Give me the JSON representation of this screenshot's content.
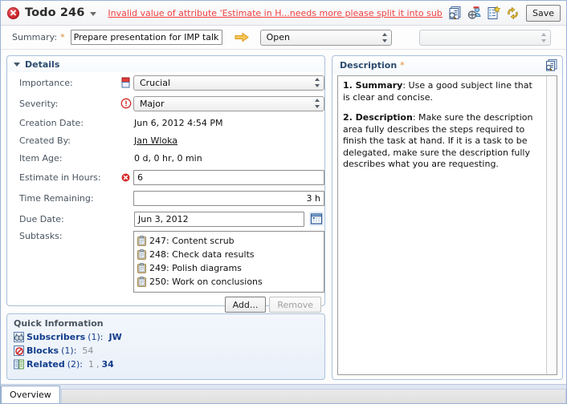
{
  "header": {
    "status_icon": "error-circle-icon",
    "title": "Todo 246",
    "dropdown_icon": "caret-down-icon",
    "error_message": "Invalid value of attribute 'Estimate in H...needs more please split it into subtasks.",
    "tools": [
      {
        "name": "inspect-icon",
        "title": "Inspect"
      },
      {
        "name": "team-icon",
        "title": "Team"
      },
      {
        "name": "new-item-icon",
        "title": "New Item"
      },
      {
        "name": "refresh-icon",
        "title": "Refresh"
      }
    ],
    "save_label": "Save"
  },
  "summary": {
    "label": "Summary:",
    "required_marker": "*",
    "value": "Prepare presentation for IMP talk",
    "placeholder": "",
    "arrow_icon": "arrow-right-icon",
    "state": {
      "value": "Open",
      "icon": "spinner-arrows-icon"
    },
    "resolution": {
      "value": "",
      "placeholder": ""
    }
  },
  "details": {
    "title": "Details",
    "collapse_icon": "triangle-down-icon",
    "importance": {
      "label": "Importance:",
      "value": "Crucial",
      "icon": "importance-flag-icon"
    },
    "severity": {
      "label": "Severity:",
      "value": "Major",
      "icon": "warning-circle-icon"
    },
    "creation_date": {
      "label": "Creation Date:",
      "value": "Jun 6, 2012 4:54 PM"
    },
    "created_by": {
      "label": "Created By:",
      "value": "Jan Wloka"
    },
    "item_age": {
      "label": "Item Age:",
      "value": "0 d, 0 hr, 0 min"
    },
    "estimate": {
      "label": "Estimate in Hours:",
      "value": "6",
      "error_icon": "field-error-icon"
    },
    "time_remaining": {
      "label": "Time Remaining:",
      "value": "3 h"
    },
    "due_date": {
      "label": "Due Date:",
      "value": "Jun 3, 2012",
      "calendar_icon": "calendar-icon"
    },
    "subtasks": {
      "label": "Subtasks:",
      "items": [
        {
          "icon": "clipboard-icon",
          "text": "247: Content scrub"
        },
        {
          "icon": "clipboard-icon",
          "text": "248: Check data results"
        },
        {
          "icon": "clipboard-icon",
          "text": "249: Polish diagrams"
        },
        {
          "icon": "clipboard-icon",
          "text": "250: Work on conclusions"
        }
      ],
      "add_label": "Add...",
      "remove_label": "Remove"
    }
  },
  "quick_information": {
    "title": "Quick Information",
    "rows": [
      {
        "icon": "subscribers-icon",
        "label": "Subscribers",
        "count": "(1):",
        "values": [
          {
            "text": "JW",
            "dim": false
          }
        ]
      },
      {
        "icon": "blocks-icon",
        "label": "Blocks",
        "count": "(1):",
        "values": [
          {
            "text": "54",
            "dim": true
          }
        ]
      },
      {
        "icon": "related-icon",
        "label": "Related",
        "count": "(2):",
        "values": [
          {
            "text": "1",
            "dim": true
          },
          {
            "text": ",",
            "dim": true
          },
          {
            "text": "34",
            "dim": false
          }
        ]
      }
    ]
  },
  "description": {
    "title": "Description",
    "required_marker": "*",
    "icon": "preview-icon",
    "paragraph1_bold": "1. Summary",
    "paragraph1_text": ": Use a good subject line that is clear and concise.",
    "paragraph2_bold": "2. Description",
    "paragraph2_text": ": Make sure the description area fully describes the steps required to finish the task at hand. If it is a task to be delegated, make sure the description fully describes what you are requesting."
  },
  "tabs": {
    "overview_label": "Overview"
  },
  "colors": {
    "error_red": "#f04040",
    "link_blue": "#16439b",
    "panel_border": "#a9c0db",
    "panel_title": "#2b4a6f",
    "label_gray": "#4a5560",
    "required_orange": "#e08a2e"
  }
}
